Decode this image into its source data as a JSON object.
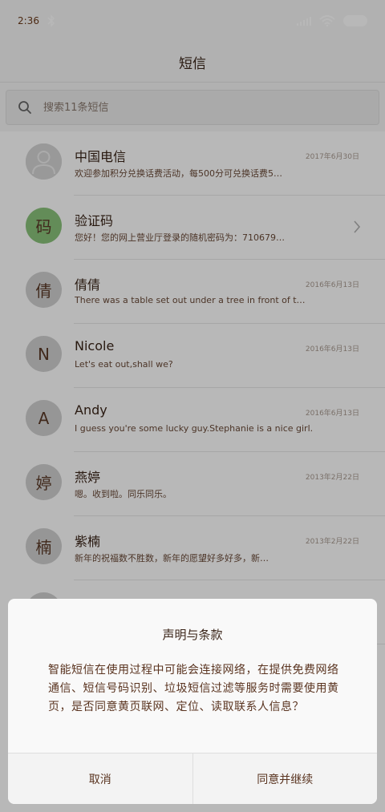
{
  "status_bar": {
    "time": "2:36"
  },
  "header": {
    "title": "短信"
  },
  "search": {
    "placeholder": "搜索11条短信"
  },
  "messages": [
    {
      "name": "中国电信",
      "time": "2017年6月30日",
      "preview": "欢迎参加积分兑换话费活动，每500分可兑换话费5…",
      "avatar": "person-icon"
    },
    {
      "name": "验证码",
      "time": "",
      "preview": "您好！您的网上营业厅登录的随机密码为：710679…",
      "avatar_text": "码"
    },
    {
      "name": "倩倩",
      "time": "2016年6月13日",
      "preview": "There was a table set out under a tree in front of t…",
      "avatar_text": "倩"
    },
    {
      "name": "Nicole",
      "time": "2016年6月13日",
      "preview": "Let's eat out,shall we?",
      "avatar_text": "N"
    },
    {
      "name": "Andy",
      "time": "2016年6月13日",
      "preview": "I guess you're some lucky guy.Stephanie is a nice girl.",
      "avatar_text": "A"
    },
    {
      "name": "燕婷",
      "time": "2013年2月22日",
      "preview": "嗯。收到啦。同乐同乐。",
      "avatar_text": "婷"
    },
    {
      "name": "紫楠",
      "time": "2013年2月22日",
      "preview": "新年的祝福数不胜数，新年的愿望好多好多，新…",
      "avatar_text": "楠"
    }
  ],
  "dialog": {
    "title": "声明与条款",
    "body": "智能短信在使用过程中可能会连接网络，在提供免费网络通信、短信号码识别、垃圾短信过滤等服务时需要使用黄页，是否同意黄页联网、定位、读取联系人信息？",
    "cancel_label": "取消",
    "confirm_label": "同意并继续"
  },
  "colors": {
    "accent_green": "#8ac27a",
    "text_brown": "#5a3420"
  }
}
